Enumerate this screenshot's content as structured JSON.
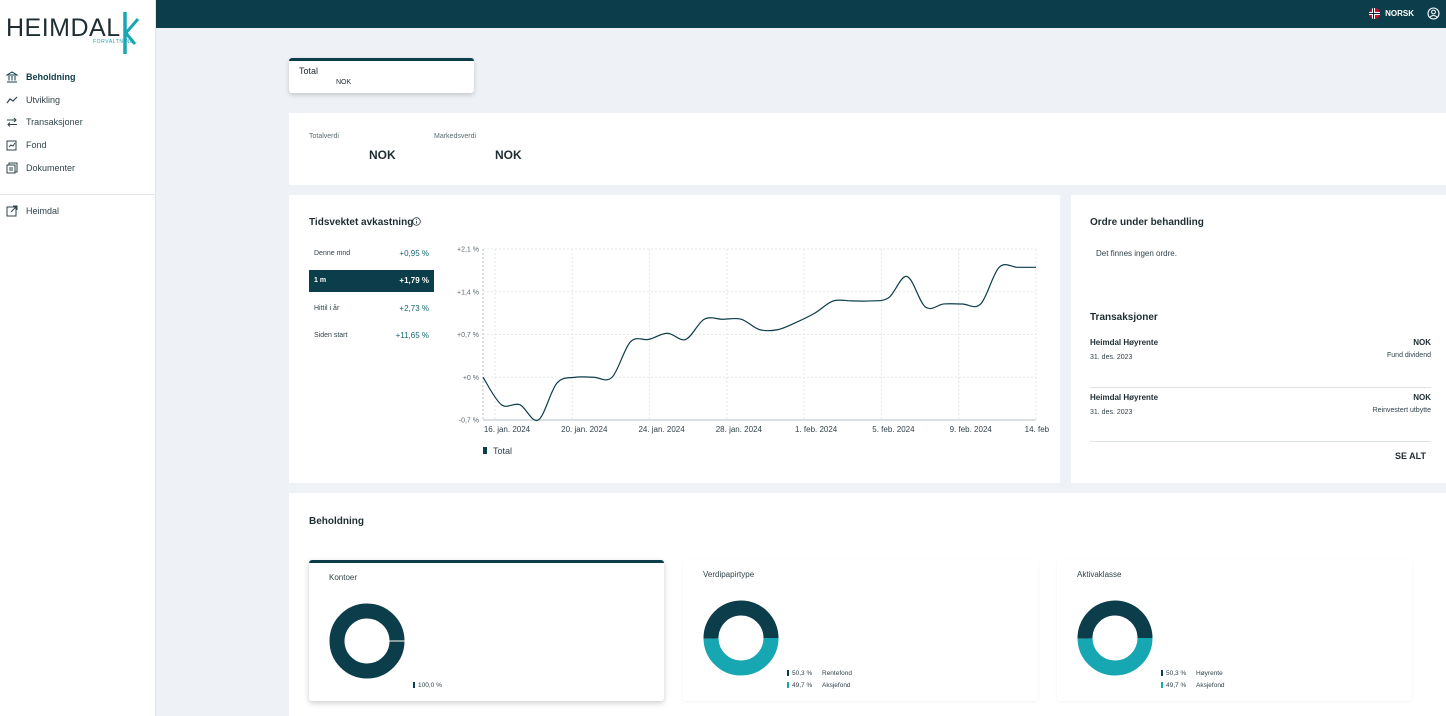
{
  "brand": {
    "name": "HEIMDAL",
    "sub": "FORVALTNING",
    "accent": "#17a7b2",
    "primary": "#0c3d4a"
  },
  "topbar": {
    "language": "NORSK"
  },
  "sidebar": {
    "items": [
      {
        "label": "Beholdning",
        "icon": "bank-icon",
        "active": true
      },
      {
        "label": "Utvikling",
        "icon": "trend-icon",
        "active": false
      },
      {
        "label": "Transaksjoner",
        "icon": "transfer-icon",
        "active": false
      },
      {
        "label": "Fond",
        "icon": "fund-icon",
        "active": false
      },
      {
        "label": "Dokumenter",
        "icon": "documents-icon",
        "active": false
      }
    ],
    "external": {
      "label": "Heimdal",
      "icon": "external-link-icon"
    }
  },
  "total_card": {
    "title": "Total",
    "currency": "NOK"
  },
  "summary": {
    "total_label": "Totalverdi",
    "total_value": "NOK",
    "market_label": "Markedsverdi",
    "market_value": "NOK"
  },
  "returns": {
    "title": "Tidsvektet avkastning",
    "periods": [
      {
        "label": "Denne mnd",
        "value": "+0,95 %",
        "active": false
      },
      {
        "label": "1 m",
        "value": "+1,79 %",
        "active": true
      },
      {
        "label": "Hittil i år",
        "value": "+2,73 %",
        "active": false
      },
      {
        "label": "Siden start",
        "value": "+11,65 %",
        "active": false
      }
    ]
  },
  "chart_data": {
    "type": "line",
    "y_ticks": [
      "+2,1 %",
      "+1,4 %",
      "+0,7 %",
      "+0 %",
      "-0,7 %"
    ],
    "x_ticks": [
      "16. jan. 2024",
      "20. jan. 2024",
      "24. jan. 2024",
      "28. jan. 2024",
      "1. feb. 2024",
      "5. feb. 2024",
      "9. feb. 2024",
      "14. feb. 2024"
    ],
    "ylim": [
      -0.7,
      2.1
    ],
    "series": [
      {
        "name": "Total",
        "color": "#0c3d4a",
        "points": [
          [
            0,
            0.0
          ],
          [
            1,
            -0.45
          ],
          [
            2,
            -0.45
          ],
          [
            3,
            -0.7
          ],
          [
            4,
            -0.1
          ],
          [
            5,
            0.0
          ],
          [
            6,
            0.0
          ],
          [
            7,
            0.0
          ],
          [
            8,
            0.58
          ],
          [
            9,
            0.62
          ],
          [
            10,
            0.72
          ],
          [
            11,
            0.62
          ],
          [
            12,
            0.95
          ],
          [
            13,
            0.95
          ],
          [
            14,
            0.95
          ],
          [
            15,
            0.78
          ],
          [
            16,
            0.78
          ],
          [
            17,
            0.9
          ],
          [
            18,
            1.05
          ],
          [
            19,
            1.25
          ],
          [
            20,
            1.25
          ],
          [
            21,
            1.25
          ],
          [
            22,
            1.3
          ],
          [
            23,
            1.65
          ],
          [
            24,
            1.15
          ],
          [
            25,
            1.2
          ],
          [
            26,
            1.2
          ],
          [
            27,
            1.2
          ],
          [
            28,
            1.8
          ],
          [
            29,
            1.8
          ],
          [
            30,
            1.8
          ]
        ]
      }
    ],
    "legend": [
      "Total"
    ]
  },
  "orders": {
    "title": "Ordre under behandling",
    "empty_text": "Det finnes ingen ordre.",
    "tx_title": "Transaksjoner",
    "transactions": [
      {
        "name": "Heimdal Høyrente",
        "date": "31. des. 2023",
        "currency": "NOK",
        "type": "Fund dividend"
      },
      {
        "name": "Heimdal Høyrente",
        "date": "31. des. 2023",
        "currency": "NOK",
        "type": "Reinvestert utbytte"
      }
    ],
    "see_all": "SE ALT"
  },
  "holdings": {
    "title": "Beholdning",
    "cards": [
      {
        "title": "Kontoer",
        "active": true,
        "slices": [
          {
            "label": "",
            "value": 100.0,
            "display": "100,0 %",
            "color": "#0c3d4a"
          }
        ]
      },
      {
        "title": "Verdipapirtype",
        "active": false,
        "slices": [
          {
            "label": "Rentefond",
            "value": 50.3,
            "display": "50,3 %",
            "color": "#0c3d4a"
          },
          {
            "label": "Aksjefond",
            "value": 49.7,
            "display": "49,7 %",
            "color": "#17a7b2"
          }
        ]
      },
      {
        "title": "Aktivaklasse",
        "active": false,
        "slices": [
          {
            "label": "Høyrente",
            "value": 50.3,
            "display": "50,3 %",
            "color": "#0c3d4a"
          },
          {
            "label": "Aksjefond",
            "value": 49.7,
            "display": "49,7 %",
            "color": "#17a7b2"
          }
        ]
      }
    ]
  }
}
